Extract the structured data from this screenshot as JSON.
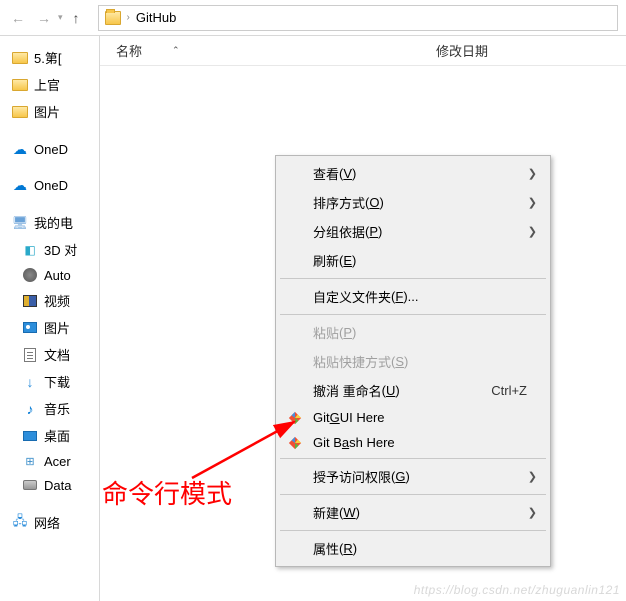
{
  "toolbar": {
    "address_folder": "GitHub"
  },
  "columns": {
    "name": "名称",
    "modified": "修改日期"
  },
  "sidebar": {
    "items": [
      {
        "label": "5.第[",
        "type": "folder"
      },
      {
        "label": "上官",
        "type": "folder"
      },
      {
        "label": "图片",
        "type": "folder"
      },
      {
        "label": "OneD",
        "type": "onedrive"
      },
      {
        "label": "OneD",
        "type": "onedrive"
      },
      {
        "label": "我的电",
        "type": "pc"
      },
      {
        "label": "3D 对",
        "type": "3d"
      },
      {
        "label": "Auto",
        "type": "autocad"
      },
      {
        "label": "视频",
        "type": "video"
      },
      {
        "label": "图片",
        "type": "pictures"
      },
      {
        "label": "文档",
        "type": "documents"
      },
      {
        "label": "下载",
        "type": "downloads"
      },
      {
        "label": "音乐",
        "type": "music"
      },
      {
        "label": "桌面",
        "type": "desktop"
      },
      {
        "label": "Acer",
        "type": "acer"
      },
      {
        "label": "Data",
        "type": "disk"
      },
      {
        "label": "网络",
        "type": "network"
      }
    ]
  },
  "context_menu": {
    "view": "查看",
    "view_key": "V",
    "sort": "排序方式",
    "sort_key": "O",
    "group": "分组依据",
    "group_key": "P",
    "refresh": "刷新",
    "refresh_key": "E",
    "customize": "自定义文件夹",
    "customize_key": "F",
    "paste": "粘贴",
    "paste_key": "P",
    "paste_shortcut": "粘贴快捷方式",
    "paste_shortcut_key": "S",
    "undo_rename": "撤消 重命名",
    "undo_key": "U",
    "undo_shortcut": "Ctrl+Z",
    "git_gui": "Git ",
    "git_gui_key": "G",
    "git_gui_suffix": "UI Here",
    "git_bash": "Git B",
    "git_bash_key": "a",
    "git_bash_suffix": "sh Here",
    "grant_access": "授予访问权限",
    "grant_access_key": "G",
    "new": "新建",
    "new_key": "W",
    "properties": "属性",
    "properties_key": "R"
  },
  "annotation": "命令行模式",
  "watermark": "https://blog.csdn.net/zhuguanlin121"
}
